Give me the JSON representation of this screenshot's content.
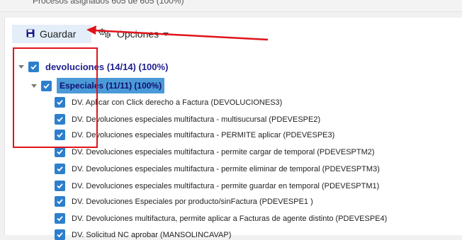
{
  "header": {
    "status_text": "Procesos asignados 605 de 605 (100%)"
  },
  "toolbar": {
    "save_label": "Guardar",
    "options_label": "Opciones"
  },
  "tree": {
    "root_label": "devoluciones (14/14) (100%)",
    "group_label": "Especiales (11/11) (100%)",
    "items": [
      "DV. Aplicar con Click derecho a Factura (DEVOLUCIONES3)",
      "DV. Devoluciones especiales multifactura - multisucursal (PDEVESPE2)",
      "DV. Devoluciones especiales multifactura - PERMITE aplicar (PDEVESPE3)",
      "DV. Devoluciones especiales multifactura - permite cargar de temporal (PDEVESPTM2)",
      "DV. Devoluciones especiales multifactura - permite eliminar de temporal (PDEVESPTM3)",
      "DV. Devoluciones especiales multifactura - permite guardar en temporal (PDEVESPTM1)",
      "DV. Devoluciones Especiales por producto/sinFactura (PDEVESPE1 )",
      "DV. Devoluciones multifactura, permite aplicar a Facturas de agente distinto (PDEVESPE4)",
      "DV. Solicitud NC aprobar (MANSOLINCAVAP)"
    ]
  },
  "colors": {
    "accent": "#2d7fcc",
    "annotation": "#e0141a",
    "node_text": "#1f1f8f"
  },
  "icons": {
    "save": "floppy-disk-icon",
    "options": "gears-icon"
  }
}
